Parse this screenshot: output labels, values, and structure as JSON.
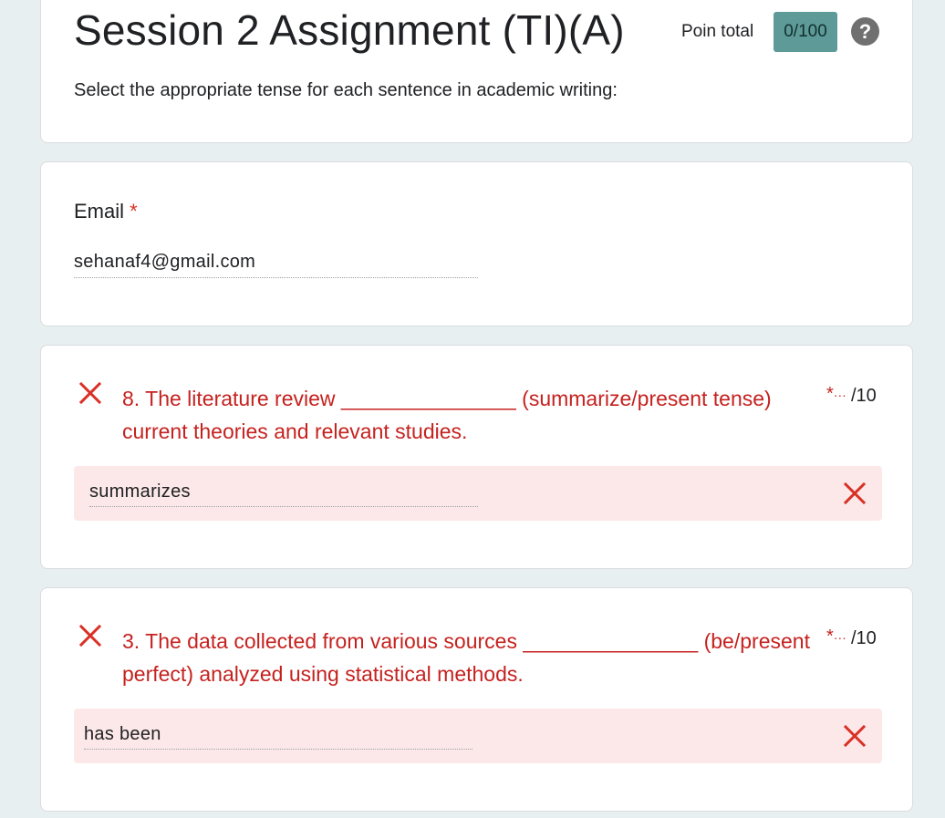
{
  "header": {
    "title": "Session 2 Assignment (TI)(A)",
    "points_label": "Poin total",
    "points_value": "0/100",
    "help_icon": "question-mark-icon",
    "description": "Select the appropriate tense for each sentence in academic writing:"
  },
  "email": {
    "label": "Email",
    "required_marker": "*",
    "value": "sehanaf4@gmail.com"
  },
  "questions": [
    {
      "text": "8. The literature review _______________ (summarize/present tense) current theories and relevant studies.",
      "required_marker": "*",
      "more_marker": "···",
      "score": "/10",
      "answer": "summarizes",
      "status": "incorrect",
      "status_icon": "close-icon"
    },
    {
      "text": "3. The data collected from various sources _______________ (be/present perfect) analyzed using statistical methods.",
      "required_marker": "*",
      "more_marker": "···",
      "score": "/10",
      "answer": "has been",
      "status": "incorrect",
      "status_icon": "close-icon"
    }
  ],
  "colors": {
    "incorrect_red": "#d93025",
    "answer_bg": "#fce8e8",
    "points_badge": "#5e9a98",
    "page_bg": "#e8eff0"
  }
}
